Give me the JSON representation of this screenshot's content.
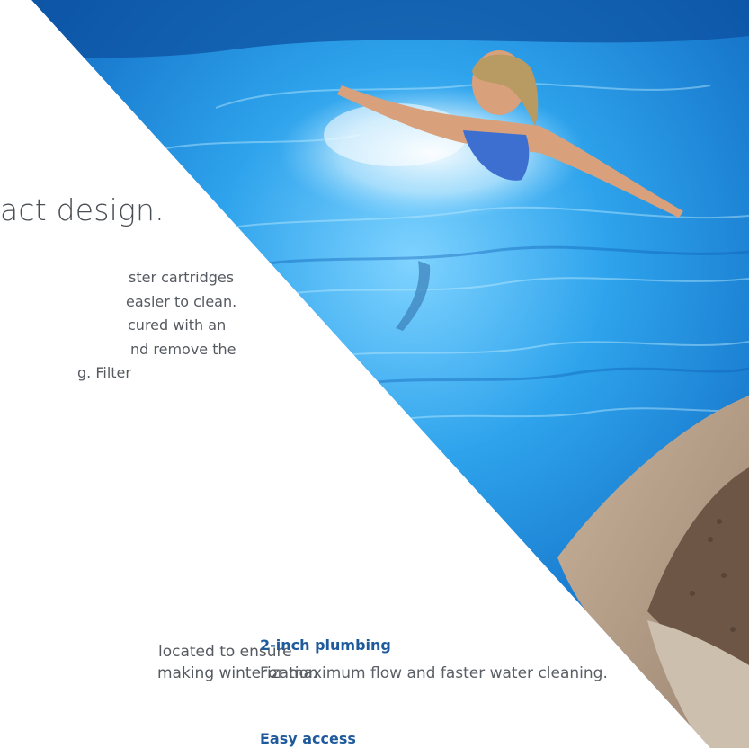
{
  "headline": "act design.",
  "body_lines": [
    "ster cartridges",
    "easier to clean.",
    "cured with an",
    "nd remove the",
    "g. Filter"
  ],
  "left_feature_lines": [
    "located to ensure",
    "making winterization"
  ],
  "features": [
    {
      "title": "2-inch plumbing",
      "description": "For maximum flow and faster water cleaning."
    },
    {
      "title": "Easy access",
      "description": ""
    }
  ],
  "colors": {
    "accent_blue": "#1e5a9c",
    "text_gray": "#555a60",
    "pool_blue": "#1f8ad6"
  }
}
